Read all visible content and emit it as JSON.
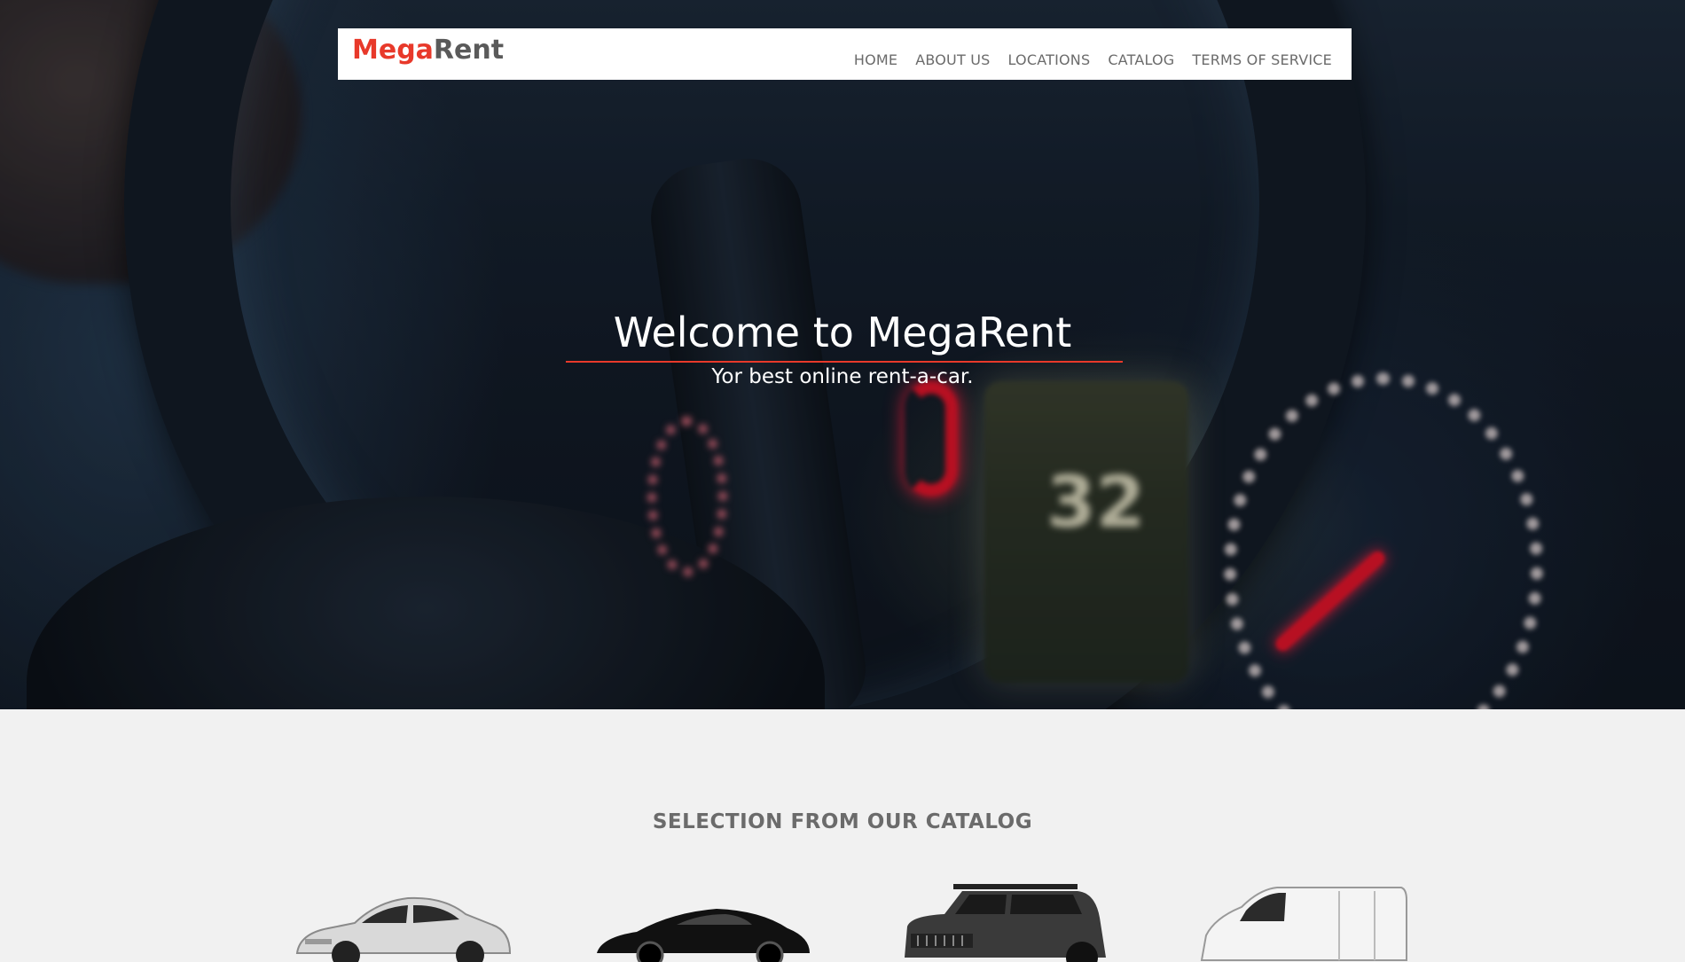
{
  "brand": {
    "part1": "Mega",
    "part2": "Rent"
  },
  "nav": {
    "items": [
      "HOME",
      "ABOUT US",
      "LOCATIONS",
      "CATALOG",
      "TERMS OF SERVICE"
    ]
  },
  "hero": {
    "title": "Welcome to MegaRent",
    "subtitle": "Yor best online rent-a-car.",
    "display_reading": "32"
  },
  "catalog": {
    "title": "SELECTION FROM OUR CATALOG",
    "items": [
      {
        "icon": "sedan-car-icon",
        "color": "#d9d9d9"
      },
      {
        "icon": "sports-car-icon",
        "color": "#111111"
      },
      {
        "icon": "suv-car-icon",
        "color": "#3a3a3a"
      },
      {
        "icon": "van-icon",
        "color": "#f4f4f4"
      }
    ]
  },
  "colors": {
    "accent": "#e8392a",
    "brand_gray": "#5a5a5a",
    "nav_text": "#6b6b6b",
    "section_bg": "#f1f1f1"
  }
}
